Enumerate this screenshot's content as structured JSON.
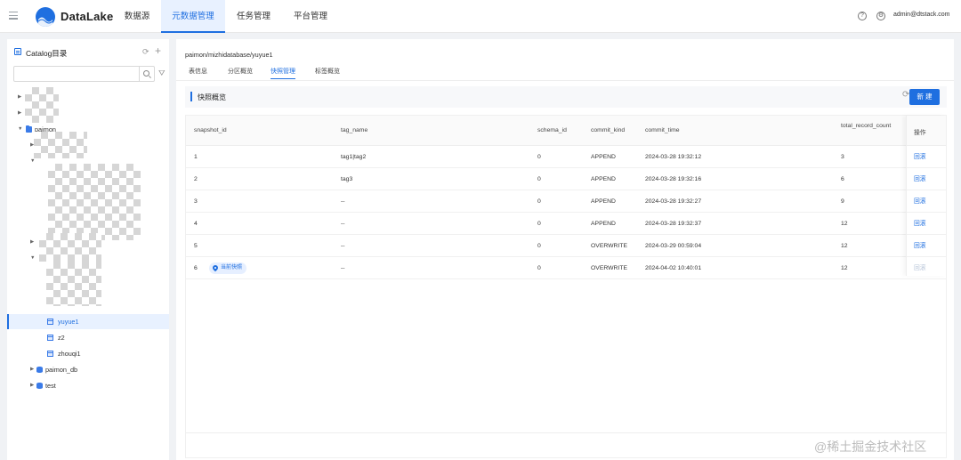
{
  "header": {
    "brand": "DataLake",
    "nav": [
      {
        "label": "数据源"
      },
      {
        "label": "元数据管理",
        "active": true
      },
      {
        "label": "任务管理"
      },
      {
        "label": "平台管理"
      }
    ],
    "user": "admin@dtstack.com",
    "icons": [
      "menu-icon",
      "help-icon",
      "settings-icon"
    ]
  },
  "sidebar": {
    "title": "Catalog目录",
    "search_placeholder": "",
    "tree": [
      {
        "label": "paimon",
        "type": "folder",
        "expanded": true
      },
      {
        "label": "yuyue1",
        "type": "table",
        "selected": true
      },
      {
        "label": "z2",
        "type": "table"
      },
      {
        "label": "zhouqi1",
        "type": "table"
      },
      {
        "label": "paimon_db",
        "type": "database"
      },
      {
        "label": "test",
        "type": "database"
      }
    ]
  },
  "main": {
    "breadcrumb": "paimon/mizhidatabase/yuyue1",
    "tabs": [
      {
        "label": "表信息"
      },
      {
        "label": "分区概览"
      },
      {
        "label": "快照管理",
        "active": true
      },
      {
        "label": "标签概览"
      }
    ],
    "section_title": "快照概览",
    "new_button": "新 建",
    "table": {
      "columns": [
        "snapshot_id",
        "tag_name",
        "schema_id",
        "commit_kind",
        "commit_time",
        "total_record_count",
        "操作"
      ],
      "rows": [
        {
          "snapshot_id": "1",
          "tag_name": "tag1|tag2",
          "schema_id": "0",
          "commit_kind": "APPEND",
          "commit_time": "2024-03-28 19:32:12",
          "total_record_count": "3",
          "op": "回滚"
        },
        {
          "snapshot_id": "2",
          "tag_name": "tag3",
          "schema_id": "0",
          "commit_kind": "APPEND",
          "commit_time": "2024-03-28 19:32:16",
          "total_record_count": "6",
          "op": "回滚"
        },
        {
          "snapshot_id": "3",
          "tag_name": "--",
          "schema_id": "0",
          "commit_kind": "APPEND",
          "commit_time": "2024-03-28 19:32:27",
          "total_record_count": "9",
          "op": "回滚"
        },
        {
          "snapshot_id": "4",
          "tag_name": "--",
          "schema_id": "0",
          "commit_kind": "APPEND",
          "commit_time": "2024-03-28 19:32:37",
          "total_record_count": "12",
          "op": "回滚"
        },
        {
          "snapshot_id": "5",
          "tag_name": "--",
          "schema_id": "0",
          "commit_kind": "OVERWRITE",
          "commit_time": "2024-03-29 00:59:04",
          "total_record_count": "12",
          "op": "回滚"
        },
        {
          "snapshot_id": "6",
          "badge": "当前快照",
          "tag_name": "--",
          "schema_id": "0",
          "commit_kind": "OVERWRITE",
          "commit_time": "2024-04-02 10:40:01",
          "total_record_count": "12",
          "op": "回滚",
          "op_disabled": true
        }
      ]
    }
  },
  "watermark": "@稀土掘金技术社区",
  "colors": {
    "accent": "#1f6fe0",
    "accent_light": "#e8f1ff"
  }
}
